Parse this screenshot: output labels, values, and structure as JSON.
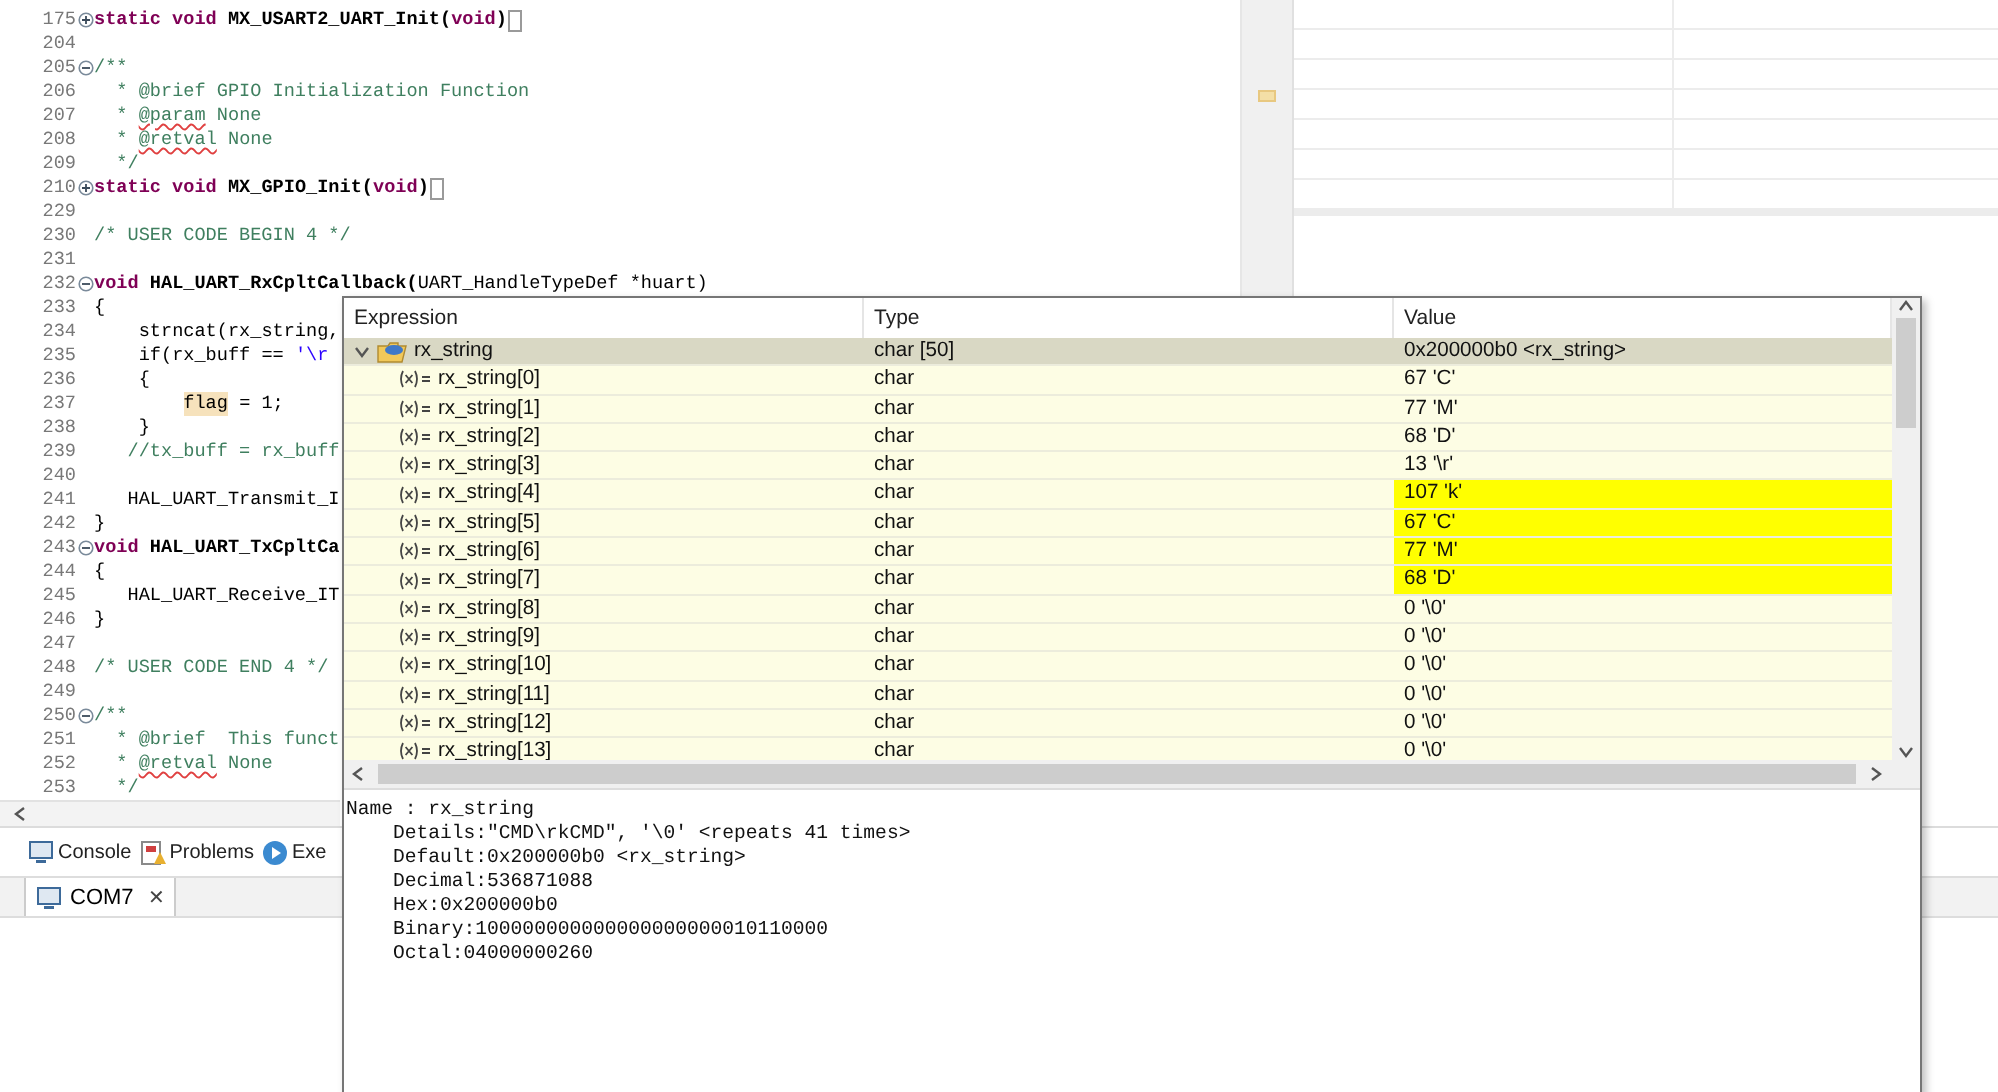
{
  "editor": {
    "lines": [
      {
        "number": "175",
        "folded": true,
        "tokens": [
          {
            "kind": "keyword",
            "text": "static void"
          },
          {
            "kind": "decl",
            "text": " MX_USART2_UART_Init("
          },
          {
            "kind": "keyword",
            "text": "void"
          },
          {
            "kind": "decl",
            "text": ")"
          }
        ]
      },
      {
        "number": "204"
      },
      {
        "number": "205",
        "folded": false,
        "tokens": [
          {
            "kind": "comment",
            "text": "/**"
          }
        ]
      },
      {
        "number": "206",
        "tokens": [
          {
            "kind": "comment",
            "text": "  * @brief GPIO Initialization Function"
          }
        ]
      },
      {
        "number": "207",
        "tokens": [
          {
            "kind": "comment",
            "text": "  * "
          },
          {
            "kind": "comment",
            "text": "@param",
            "misspelled": true
          },
          {
            "kind": "comment",
            "text": " None"
          }
        ]
      },
      {
        "number": "208",
        "tokens": [
          {
            "kind": "comment",
            "text": "  * "
          },
          {
            "kind": "comment",
            "text": "@retval",
            "misspelled": true
          },
          {
            "kind": "comment",
            "text": " None"
          }
        ]
      },
      {
        "number": "209",
        "tokens": [
          {
            "kind": "comment",
            "text": "  */"
          }
        ]
      },
      {
        "number": "210",
        "folded": true,
        "tokens": [
          {
            "kind": "keyword",
            "text": "static void"
          },
          {
            "kind": "decl",
            "text": " MX_GPIO_Init("
          },
          {
            "kind": "keyword",
            "text": "void"
          },
          {
            "kind": "decl",
            "text": ")"
          }
        ]
      },
      {
        "number": "229"
      },
      {
        "number": "230",
        "tokens": [
          {
            "kind": "comment",
            "text": "/* USER CODE BEGIN 4 */"
          }
        ]
      },
      {
        "number": "231"
      },
      {
        "number": "232",
        "folded": false,
        "tokens": [
          {
            "kind": "keyword",
            "text": "void"
          },
          {
            "kind": "decl",
            "text": " HAL_UART_RxCpltCallback("
          },
          {
            "kind": "plain",
            "text": "UART_HandleTypeDef *huart)"
          }
        ]
      },
      {
        "number": "233",
        "tokens": [
          {
            "kind": "plain",
            "text": "{"
          }
        ]
      },
      {
        "number": "234",
        "tokens": [
          {
            "kind": "plain",
            "text": "    strncat(rx_string,"
          }
        ]
      },
      {
        "number": "235",
        "tokens": [
          {
            "kind": "plain",
            "text": "    if(rx_buff == "
          },
          {
            "kind": "string",
            "text": "'\\r"
          }
        ]
      },
      {
        "number": "236",
        "tokens": [
          {
            "kind": "plain",
            "text": "    {"
          }
        ]
      },
      {
        "number": "237",
        "tokens": [
          {
            "kind": "plain",
            "text": "        flag",
            "highlighted": true
          },
          {
            "kind": "plain",
            "text": " = 1;"
          }
        ]
      },
      {
        "number": "238",
        "tokens": [
          {
            "kind": "plain",
            "text": "    }"
          }
        ]
      },
      {
        "number": "239",
        "tokens": [
          {
            "kind": "comment",
            "text": "   //tx_buff = rx_buff"
          }
        ]
      },
      {
        "number": "240"
      },
      {
        "number": "241",
        "tokens": [
          {
            "kind": "plain",
            "text": "   HAL_UART_Transmit_I"
          }
        ]
      },
      {
        "number": "242",
        "tokens": [
          {
            "kind": "plain",
            "text": "}"
          }
        ]
      },
      {
        "number": "243",
        "folded": false,
        "tokens": [
          {
            "kind": "keyword",
            "text": "void"
          },
          {
            "kind": "decl",
            "text": " HAL_UART_TxCpltCa"
          }
        ]
      },
      {
        "number": "244",
        "tokens": [
          {
            "kind": "plain",
            "text": "{"
          }
        ]
      },
      {
        "number": "245",
        "tokens": [
          {
            "kind": "plain",
            "text": "   HAL_UART_Receive_IT"
          }
        ]
      },
      {
        "number": "246",
        "tokens": [
          {
            "kind": "plain",
            "text": "}"
          }
        ]
      },
      {
        "number": "247"
      },
      {
        "number": "248",
        "tokens": [
          {
            "kind": "comment",
            "text": "/* USER CODE END 4 */"
          }
        ]
      },
      {
        "number": "249"
      },
      {
        "number": "250",
        "folded": false,
        "tokens": [
          {
            "kind": "comment",
            "text": "/**"
          }
        ]
      },
      {
        "number": "251",
        "tokens": [
          {
            "kind": "comment",
            "text": "  * @brief  This funct"
          }
        ]
      },
      {
        "number": "252",
        "tokens": [
          {
            "kind": "comment",
            "text": "  * "
          },
          {
            "kind": "comment",
            "text": "@retval",
            "misspelled": true
          },
          {
            "kind": "comment",
            "text": " None"
          }
        ]
      },
      {
        "number": "253",
        "tokens": [
          {
            "kind": "comment",
            "text": "  */"
          }
        ]
      }
    ]
  },
  "bottom_panel": {
    "tabs": [
      {
        "label": "Console"
      },
      {
        "label": "Problems"
      },
      {
        "label": "Exe"
      }
    ],
    "console_tab": {
      "label": "COM7",
      "close": "✕"
    }
  },
  "expression_popup": {
    "columns": [
      "Expression",
      "Type",
      "Value"
    ],
    "rows": [
      {
        "kind": "parent",
        "expression": "rx_string",
        "type": "char [50]",
        "value": "0x200000b0 <rx_string>",
        "selected": true,
        "expanded": true,
        "changed": false
      },
      {
        "kind": "child",
        "expression": "rx_string[0]",
        "type": "char",
        "value": "67 'C'",
        "selected": false,
        "changed": false
      },
      {
        "kind": "child",
        "expression": "rx_string[1]",
        "type": "char",
        "value": "77 'M'",
        "selected": false,
        "changed": false
      },
      {
        "kind": "child",
        "expression": "rx_string[2]",
        "type": "char",
        "value": "68 'D'",
        "selected": false,
        "changed": false
      },
      {
        "kind": "child",
        "expression": "rx_string[3]",
        "type": "char",
        "value": "13 '\\r'",
        "selected": false,
        "changed": false
      },
      {
        "kind": "child",
        "expression": "rx_string[4]",
        "type": "char",
        "value": "107 'k'",
        "selected": false,
        "changed": true
      },
      {
        "kind": "child",
        "expression": "rx_string[5]",
        "type": "char",
        "value": "67 'C'",
        "selected": false,
        "changed": true
      },
      {
        "kind": "child",
        "expression": "rx_string[6]",
        "type": "char",
        "value": "77 'M'",
        "selected": false,
        "changed": true
      },
      {
        "kind": "child",
        "expression": "rx_string[7]",
        "type": "char",
        "value": "68 'D'",
        "selected": false,
        "changed": true
      },
      {
        "kind": "child",
        "expression": "rx_string[8]",
        "type": "char",
        "value": "0 '\\0'",
        "selected": false,
        "changed": false
      },
      {
        "kind": "child",
        "expression": "rx_string[9]",
        "type": "char",
        "value": "0 '\\0'",
        "selected": false,
        "changed": false
      },
      {
        "kind": "child",
        "expression": "rx_string[10]",
        "type": "char",
        "value": "0 '\\0'",
        "selected": false,
        "changed": false
      },
      {
        "kind": "child",
        "expression": "rx_string[11]",
        "type": "char",
        "value": "0 '\\0'",
        "selected": false,
        "changed": false
      },
      {
        "kind": "child",
        "expression": "rx_string[12]",
        "type": "char",
        "value": "0 '\\0'",
        "selected": false,
        "changed": false
      },
      {
        "kind": "child",
        "expression": "rx_string[13]",
        "type": "char",
        "value": "0 '\\0'",
        "selected": false,
        "changed": false
      }
    ],
    "details": [
      "Name : rx_string",
      "    Details:\"CMD\\rkCMD\", '\\0' <repeats 41 times>",
      "    Default:0x200000b0 <rx_string>",
      "    Decimal:536871088",
      "    Hex:0x200000b0",
      "    Binary:100000000000000000000010110000",
      "    Octal:04000000260"
    ]
  }
}
